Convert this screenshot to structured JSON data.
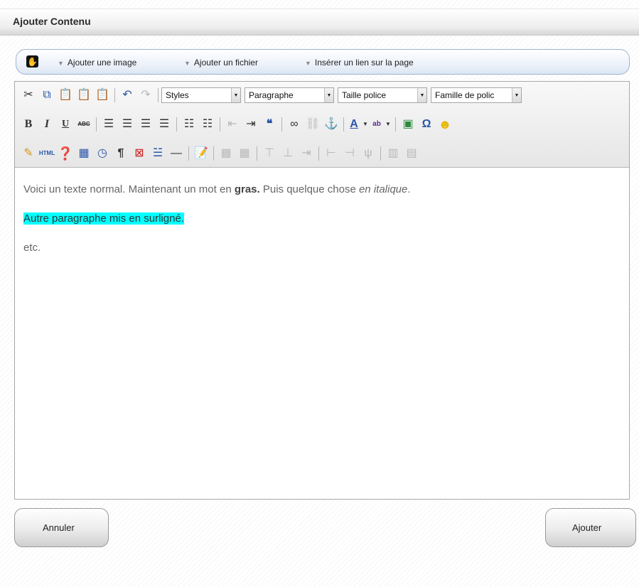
{
  "titlebar": {
    "title": "Ajouter Contenu"
  },
  "addbar": {
    "add_image": "Ajouter une image",
    "add_file": "Ajouter un fichier",
    "insert_link": "Insérer un lien sur la page"
  },
  "toolbar": {
    "styles": "Styles",
    "format": "Paragraphe",
    "font_size": "Taille police",
    "font_family": "Famille de polic",
    "bold": "B",
    "italic": "I",
    "underline": "U",
    "strike": "ABC",
    "html": "HTML",
    "pilcrow": "¶",
    "omega": "Ω",
    "text_color": "A",
    "highlight": "ab"
  },
  "content": {
    "p1_text1": "Voici un texte normal. Maintenant un mot en ",
    "p1_bold": "gras.",
    "p1_text2": " Puis quelque chose ",
    "p1_italic": "en italique",
    "p1_text3": ".",
    "p2": "Autre paragraphe mis en surligné.",
    "p3": "etc."
  },
  "buttons": {
    "cancel": "Annuler",
    "add": "Ajouter"
  },
  "colors": {
    "highlight": "#00ffff",
    "editor_border": "#a8a8a8"
  }
}
